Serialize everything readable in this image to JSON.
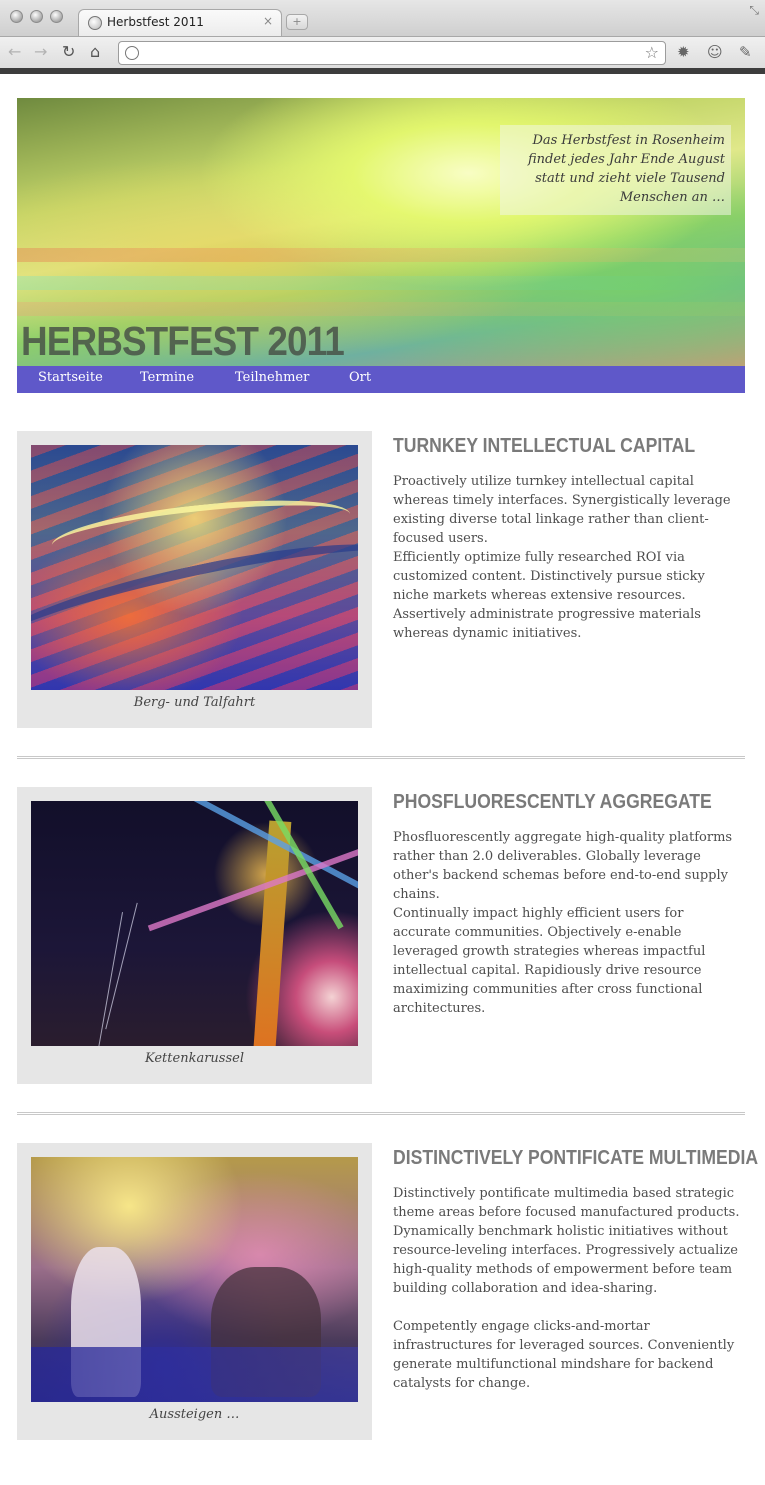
{
  "browser": {
    "tab_title": "Herbstfest 2011",
    "tab_close": "×",
    "new_tab": "+",
    "address": ""
  },
  "banner": {
    "intro": "Das Herbstfest in Rosenheim findet jedes Jahr Ende August statt und zieht viele Tausend Menschen an …",
    "title": "HERBSTFEST 2011"
  },
  "nav": {
    "items": [
      "Startseite",
      "Termine",
      "Teilnehmer",
      "Ort"
    ]
  },
  "sections": [
    {
      "caption": "Berg- und Talfahrt",
      "title": "TURNKEY INTELLECTUAL CAPITAL",
      "paragraphs": [
        "Proactively utilize turnkey intellectual capital whereas timely interfaces. Synergistically leverage existing diverse total linkage rather than client-focused users.",
        "Efficiently optimize fully researched ROI via customized content. Distinctively pursue sticky niche markets whereas extensive resources. Assertively administrate progressive materials whereas dynamic initiatives."
      ]
    },
    {
      "caption": "Kettenkarussel",
      "title": "PHOSFLUORESCENTLY AGGREGATE",
      "paragraphs": [
        "Phosfluorescently aggregate high-quality platforms rather than 2.0 deliverables. Globally leverage other's backend schemas before end-to-end supply chains.",
        "Continually impact highly efficient users for accurate communities. Objectively e-enable leveraged growth strategies whereas impactful intellectual capital. Rapidiously drive resource maximizing communities after cross functional architectures."
      ]
    },
    {
      "caption": "Aussteigen …",
      "title": "DISTINCTIVELY PONTIFICATE MULTIMEDIA",
      "paragraphs": [
        "Distinctively pontificate multimedia based strategic theme areas before focused manufactured products. Dynamically benchmark holistic initiatives without resource-leveling interfaces. Progressively actualize high-quality methods of empowerment before team building collaboration and idea-sharing.",
        "Competently engage clicks-and-mortar infrastructures for leveraged sources. Conveniently generate multifunctional mindshare for backend catalysts for change."
      ]
    }
  ],
  "colors": {
    "nav_background": "#5f58c9",
    "figure_background": "#e6e6e6",
    "heading": "#7a7a7a"
  },
  "icons": [
    "back-arrow-icon",
    "forward-arrow-icon",
    "reload-icon",
    "home-icon",
    "globe-icon",
    "bookmark-star-icon",
    "gear-icon",
    "face-icon",
    "wrench-icon"
  ]
}
